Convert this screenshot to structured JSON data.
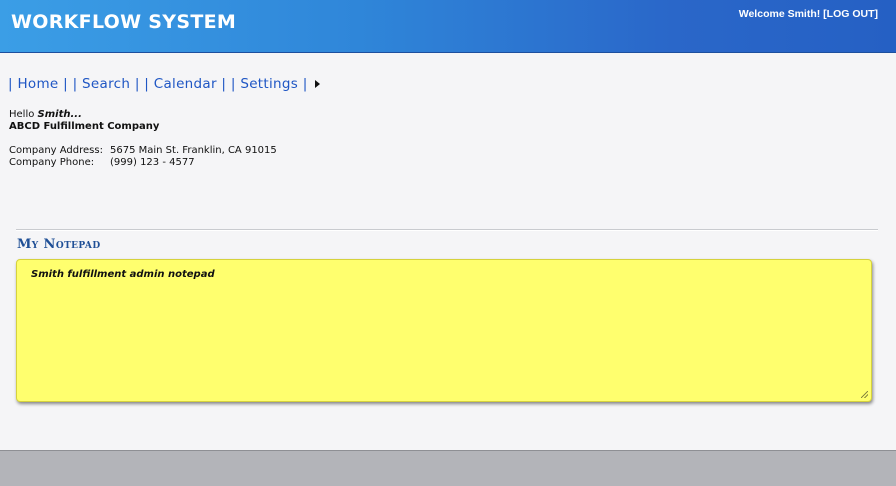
{
  "header": {
    "title": "WORKFLOW SYSTEM",
    "welcome_text": "Welcome Smith!",
    "logout_label": "[LOG OUT]"
  },
  "nav": {
    "items": [
      {
        "label": "Home"
      },
      {
        "label": "Search"
      },
      {
        "label": "Calendar"
      },
      {
        "label": "Settings"
      }
    ],
    "separator": "|"
  },
  "info": {
    "greeting": "Hello",
    "username": "Smith...",
    "company_name": "ABCD Fulfillment Company",
    "address_label": "Company Address:",
    "address_value": "5675 Main St. Franklin, CA 91015",
    "phone_label": "Company Phone:",
    "phone_value": "(999) 123 - 4577"
  },
  "notepad": {
    "title": "My Notepad",
    "content": "Smith fulfillment admin notepad"
  },
  "colors": {
    "header_gradient_start": "#3b9ee6",
    "header_gradient_end": "#2560c4",
    "nav_link": "#1f56c4",
    "notepad_title": "#1f4f96",
    "notepad_bg": "#ffff6e",
    "footer_bg": "#b3b4b9"
  }
}
